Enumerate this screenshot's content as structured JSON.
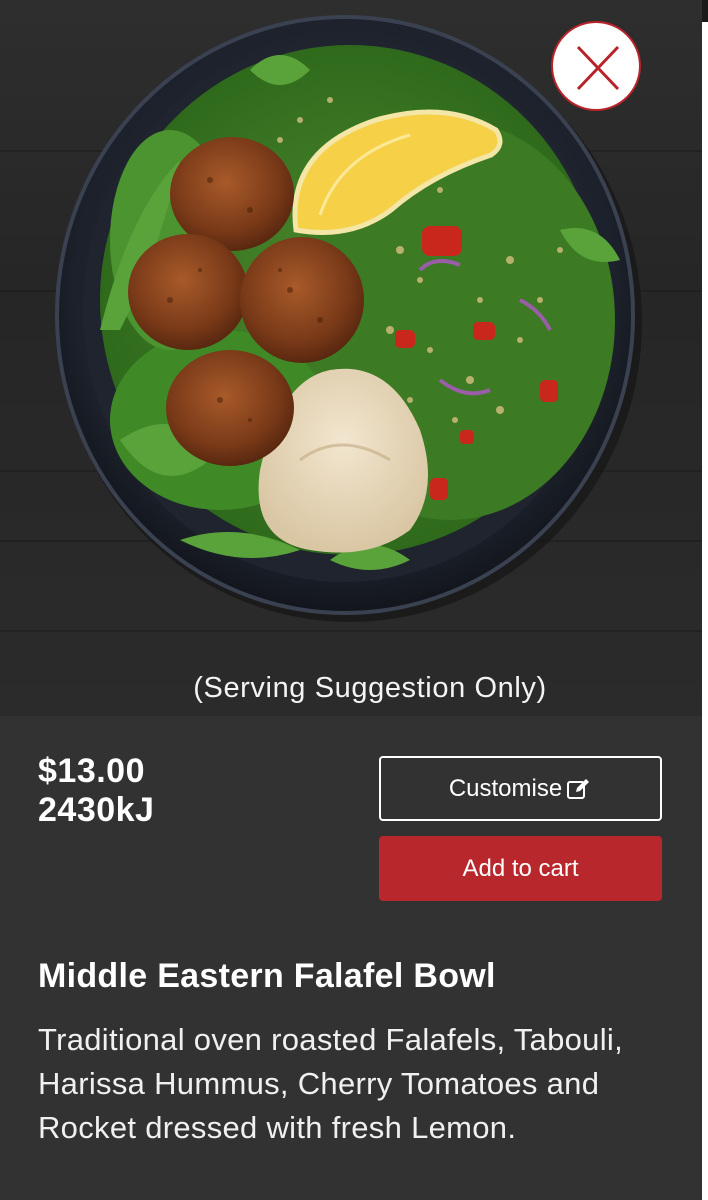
{
  "close": {
    "icon": "close-icon",
    "accent": "#b8232a"
  },
  "image": {
    "caption": "(Serving Suggestion Only)"
  },
  "product": {
    "price": "$13.00",
    "energy": "2430kJ",
    "name": "Middle Eastern Falafel Bowl",
    "description": "Traditional oven roasted Falafels, Tabouli, Harissa Hummus, Cherry Tomatoes and Rocket dressed with fresh Lemon."
  },
  "actions": {
    "customise_label": "Customise",
    "customise_icon": "edit-icon",
    "add_to_cart_label": "Add to cart",
    "add_to_cart_color": "#b8272b"
  }
}
